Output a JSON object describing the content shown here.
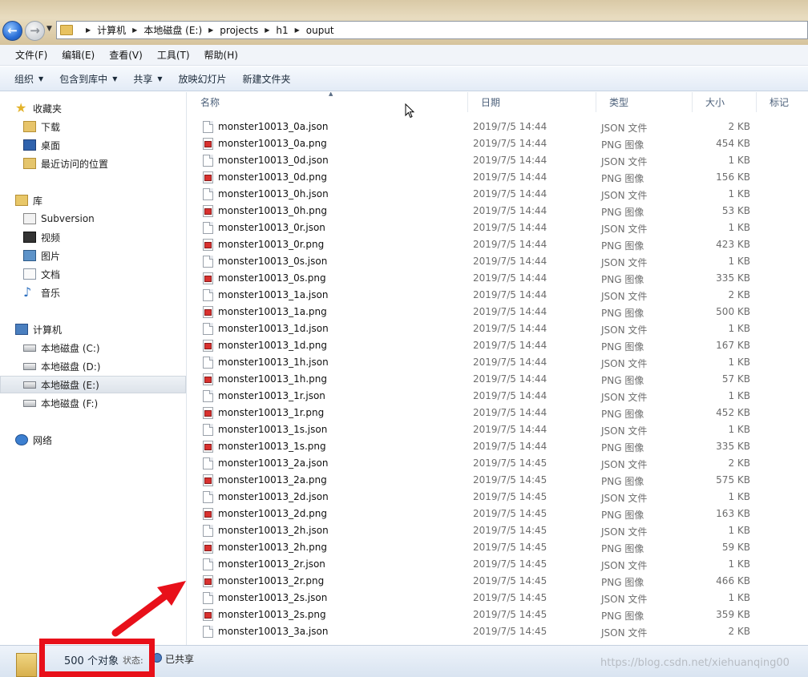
{
  "address": {
    "crumbs": [
      "计算机",
      "本地磁盘 (E:)",
      "projects",
      "h1",
      "ouput"
    ]
  },
  "menu": [
    "文件(F)",
    "编辑(E)",
    "查看(V)",
    "工具(T)",
    "帮助(H)"
  ],
  "commands": {
    "organize": "组织",
    "include_library": "包含到库中",
    "share": "共享",
    "slideshow": "放映幻灯片",
    "new_folder": "新建文件夹"
  },
  "nav": {
    "favorites": "收藏夹",
    "downloads": "下载",
    "desktop": "桌面",
    "recent": "最近访问的位置",
    "libraries": "库",
    "subversion": "Subversion",
    "videos": "视频",
    "pictures": "图片",
    "documents": "文档",
    "music": "音乐",
    "computer": "计算机",
    "drive_c": "本地磁盘 (C:)",
    "drive_d": "本地磁盘 (D:)",
    "drive_e": "本地磁盘 (E:)",
    "drive_f": "本地磁盘 (F:)",
    "network": "网络"
  },
  "columns": {
    "name": "名称",
    "date": "日期",
    "type": "类型",
    "size": "大小",
    "tags": "标记"
  },
  "files": [
    {
      "name": "monster10013_0a.json",
      "date": "2019/7/5 14:44",
      "type": "JSON 文件",
      "size": "2 KB",
      "kind": "json"
    },
    {
      "name": "monster10013_0a.png",
      "date": "2019/7/5 14:44",
      "type": "PNG 图像",
      "size": "454 KB",
      "kind": "png"
    },
    {
      "name": "monster10013_0d.json",
      "date": "2019/7/5 14:44",
      "type": "JSON 文件",
      "size": "1 KB",
      "kind": "json"
    },
    {
      "name": "monster10013_0d.png",
      "date": "2019/7/5 14:44",
      "type": "PNG 图像",
      "size": "156 KB",
      "kind": "png"
    },
    {
      "name": "monster10013_0h.json",
      "date": "2019/7/5 14:44",
      "type": "JSON 文件",
      "size": "1 KB",
      "kind": "json"
    },
    {
      "name": "monster10013_0h.png",
      "date": "2019/7/5 14:44",
      "type": "PNG 图像",
      "size": "53 KB",
      "kind": "png"
    },
    {
      "name": "monster10013_0r.json",
      "date": "2019/7/5 14:44",
      "type": "JSON 文件",
      "size": "1 KB",
      "kind": "json"
    },
    {
      "name": "monster10013_0r.png",
      "date": "2019/7/5 14:44",
      "type": "PNG 图像",
      "size": "423 KB",
      "kind": "png"
    },
    {
      "name": "monster10013_0s.json",
      "date": "2019/7/5 14:44",
      "type": "JSON 文件",
      "size": "1 KB",
      "kind": "json"
    },
    {
      "name": "monster10013_0s.png",
      "date": "2019/7/5 14:44",
      "type": "PNG 图像",
      "size": "335 KB",
      "kind": "png"
    },
    {
      "name": "monster10013_1a.json",
      "date": "2019/7/5 14:44",
      "type": "JSON 文件",
      "size": "2 KB",
      "kind": "json"
    },
    {
      "name": "monster10013_1a.png",
      "date": "2019/7/5 14:44",
      "type": "PNG 图像",
      "size": "500 KB",
      "kind": "png"
    },
    {
      "name": "monster10013_1d.json",
      "date": "2019/7/5 14:44",
      "type": "JSON 文件",
      "size": "1 KB",
      "kind": "json"
    },
    {
      "name": "monster10013_1d.png",
      "date": "2019/7/5 14:44",
      "type": "PNG 图像",
      "size": "167 KB",
      "kind": "png"
    },
    {
      "name": "monster10013_1h.json",
      "date": "2019/7/5 14:44",
      "type": "JSON 文件",
      "size": "1 KB",
      "kind": "json"
    },
    {
      "name": "monster10013_1h.png",
      "date": "2019/7/5 14:44",
      "type": "PNG 图像",
      "size": "57 KB",
      "kind": "png"
    },
    {
      "name": "monster10013_1r.json",
      "date": "2019/7/5 14:44",
      "type": "JSON 文件",
      "size": "1 KB",
      "kind": "json"
    },
    {
      "name": "monster10013_1r.png",
      "date": "2019/7/5 14:44",
      "type": "PNG 图像",
      "size": "452 KB",
      "kind": "png"
    },
    {
      "name": "monster10013_1s.json",
      "date": "2019/7/5 14:44",
      "type": "JSON 文件",
      "size": "1 KB",
      "kind": "json"
    },
    {
      "name": "monster10013_1s.png",
      "date": "2019/7/5 14:44",
      "type": "PNG 图像",
      "size": "335 KB",
      "kind": "png"
    },
    {
      "name": "monster10013_2a.json",
      "date": "2019/7/5 14:45",
      "type": "JSON 文件",
      "size": "2 KB",
      "kind": "json"
    },
    {
      "name": "monster10013_2a.png",
      "date": "2019/7/5 14:45",
      "type": "PNG 图像",
      "size": "575 KB",
      "kind": "png"
    },
    {
      "name": "monster10013_2d.json",
      "date": "2019/7/5 14:45",
      "type": "JSON 文件",
      "size": "1 KB",
      "kind": "json"
    },
    {
      "name": "monster10013_2d.png",
      "date": "2019/7/5 14:45",
      "type": "PNG 图像",
      "size": "163 KB",
      "kind": "png"
    },
    {
      "name": "monster10013_2h.json",
      "date": "2019/7/5 14:45",
      "type": "JSON 文件",
      "size": "1 KB",
      "kind": "json"
    },
    {
      "name": "monster10013_2h.png",
      "date": "2019/7/5 14:45",
      "type": "PNG 图像",
      "size": "59 KB",
      "kind": "png"
    },
    {
      "name": "monster10013_2r.json",
      "date": "2019/7/5 14:45",
      "type": "JSON 文件",
      "size": "1 KB",
      "kind": "json"
    },
    {
      "name": "monster10013_2r.png",
      "date": "2019/7/5 14:45",
      "type": "PNG 图像",
      "size": "466 KB",
      "kind": "png"
    },
    {
      "name": "monster10013_2s.json",
      "date": "2019/7/5 14:45",
      "type": "JSON 文件",
      "size": "1 KB",
      "kind": "json"
    },
    {
      "name": "monster10013_2s.png",
      "date": "2019/7/5 14:45",
      "type": "PNG 图像",
      "size": "359 KB",
      "kind": "png"
    },
    {
      "name": "monster10013_3a.json",
      "date": "2019/7/5 14:45",
      "type": "JSON 文件",
      "size": "2 KB",
      "kind": "json"
    }
  ],
  "status": {
    "count": "500 个对象",
    "state_label": "状态:",
    "shared": "已共享",
    "watermark": "https://blog.csdn.net/xiehuanqing00"
  },
  "colors": {
    "annotation_red": "#e8101a",
    "accent_blue": "#2a6ed6"
  }
}
